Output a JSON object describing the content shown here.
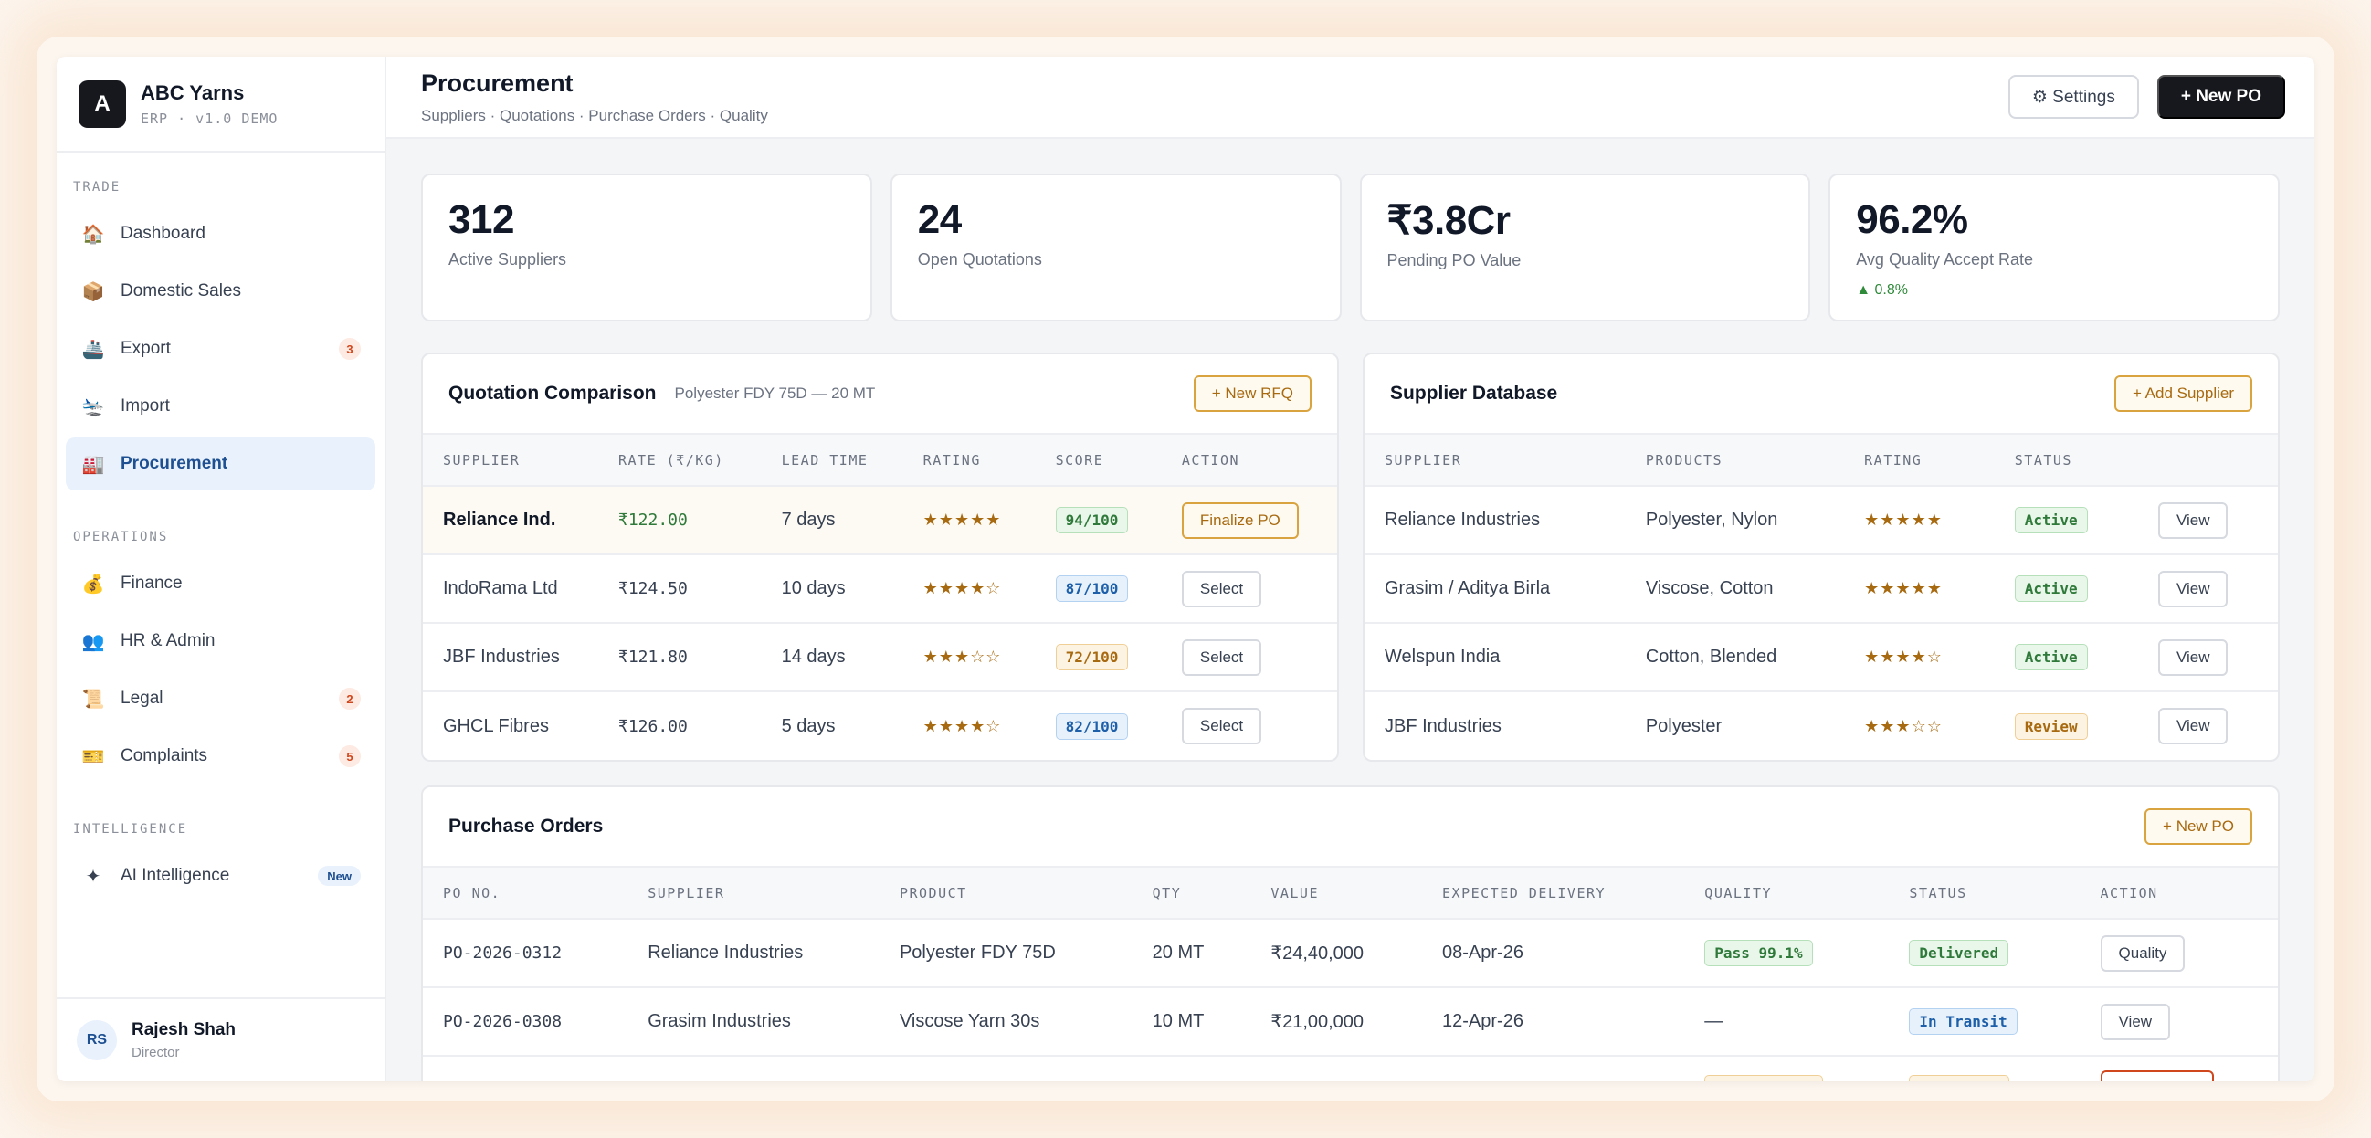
{
  "brand": {
    "logo": "A",
    "name": "ABC Yarns",
    "sub": "ERP · v1.0 DEMO"
  },
  "nav": {
    "sections": [
      {
        "title": "TRADE",
        "items": [
          {
            "label": "Dashboard",
            "icon": "🏠",
            "icon_name": "house-icon"
          },
          {
            "label": "Domestic Sales",
            "icon": "📦",
            "icon_name": "package-icon"
          },
          {
            "label": "Export",
            "icon": "🚢",
            "icon_name": "ship-icon",
            "badge": "3"
          },
          {
            "label": "Import",
            "icon": "🛬",
            "icon_name": "plane-arrival-icon"
          },
          {
            "label": "Procurement",
            "icon": "🏭",
            "icon_name": "factory-icon",
            "active": true
          }
        ]
      },
      {
        "title": "OPERATIONS",
        "items": [
          {
            "label": "Finance",
            "icon": "💰",
            "icon_name": "money-bag-icon"
          },
          {
            "label": "HR & Admin",
            "icon": "👥",
            "icon_name": "people-icon"
          },
          {
            "label": "Legal",
            "icon": "📜",
            "icon_name": "scroll-icon",
            "badge": "2"
          },
          {
            "label": "Complaints",
            "icon": "🎫",
            "icon_name": "ticket-icon",
            "badge": "5"
          }
        ]
      },
      {
        "title": "INTELLIGENCE",
        "items": [
          {
            "label": "AI Intelligence",
            "icon": "✦",
            "icon_name": "sparkle-icon",
            "tag": "New"
          }
        ]
      }
    ]
  },
  "user": {
    "initials": "RS",
    "name": "Rajesh Shah",
    "role": "Director"
  },
  "header": {
    "title": "Procurement",
    "breadcrumb": "Suppliers · Quotations · Purchase Orders · Quality",
    "settings_label": "⚙ Settings",
    "new_po_label": "+ New PO"
  },
  "kpis": [
    {
      "value": "312",
      "label": "Active Suppliers"
    },
    {
      "value": "24",
      "label": "Open Quotations"
    },
    {
      "value": "₹3.8Cr",
      "label": "Pending PO Value"
    },
    {
      "value": "96.2%",
      "label": "Avg Quality Accept Rate",
      "delta": "▲ 0.8%"
    }
  ],
  "quotation": {
    "title": "Quotation Comparison",
    "subtitle": "Polyester FDY 75D — 20 MT",
    "button": "+ New RFQ",
    "columns": [
      "SUPPLIER",
      "RATE (₹/KG)",
      "LEAD TIME",
      "RATING",
      "SCORE",
      "ACTION"
    ],
    "rows": [
      {
        "supplier": "Reliance Ind.",
        "rate": "₹122.00",
        "lead": "7 days",
        "rating": "★★★★★",
        "score": "94/100",
        "score_tone": "green",
        "action": "Finalize PO",
        "highlight": true
      },
      {
        "supplier": "IndoRama Ltd",
        "rate": "₹124.50",
        "lead": "10 days",
        "rating": "★★★★☆",
        "score": "87/100",
        "score_tone": "blue",
        "action": "Select"
      },
      {
        "supplier": "JBF Industries",
        "rate": "₹121.80",
        "lead": "14 days",
        "rating": "★★★☆☆",
        "score": "72/100",
        "score_tone": "amber",
        "action": "Select"
      },
      {
        "supplier": "GHCL Fibres",
        "rate": "₹126.00",
        "lead": "5 days",
        "rating": "★★★★☆",
        "score": "82/100",
        "score_tone": "blue",
        "action": "Select"
      }
    ]
  },
  "suppliers": {
    "title": "Supplier Database",
    "button": "+ Add Supplier",
    "columns": [
      "SUPPLIER",
      "PRODUCTS",
      "RATING",
      "STATUS",
      ""
    ],
    "rows": [
      {
        "name": "Reliance Industries",
        "products": "Polyester, Nylon",
        "rating": "★★★★★",
        "status": "Active",
        "tone": "green",
        "action": "View"
      },
      {
        "name": "Grasim / Aditya Birla",
        "products": "Viscose, Cotton",
        "rating": "★★★★★",
        "status": "Active",
        "tone": "green",
        "action": "View"
      },
      {
        "name": "Welspun India",
        "products": "Cotton, Blended",
        "rating": "★★★★☆",
        "status": "Active",
        "tone": "green",
        "action": "View"
      },
      {
        "name": "JBF Industries",
        "products": "Polyester",
        "rating": "★★★☆☆",
        "status": "Review",
        "tone": "amber",
        "action": "View"
      }
    ]
  },
  "purchase_orders": {
    "title": "Purchase Orders",
    "button": "+ New PO",
    "columns": [
      "PO NO.",
      "SUPPLIER",
      "PRODUCT",
      "QTY",
      "VALUE",
      "EXPECTED DELIVERY",
      "QUALITY",
      "STATUS",
      "ACTION"
    ],
    "rows": [
      {
        "po": "PO-2026-0312",
        "supplier": "Reliance Industries",
        "product": "Polyester FDY 75D",
        "qty": "20 MT",
        "value": "₹24,40,000",
        "delivery": "08-Apr-26",
        "quality": "Pass 99.1%",
        "quality_tone": "green",
        "status": "Delivered",
        "status_tone": "green",
        "action": "Quality"
      },
      {
        "po": "PO-2026-0308",
        "supplier": "Grasim Industries",
        "product": "Viscose Yarn 30s",
        "qty": "10 MT",
        "value": "₹21,00,000",
        "delivery": "12-Apr-26",
        "quality": "—",
        "quality_tone": "",
        "status": "In Transit",
        "status_tone": "blue",
        "action": "View"
      },
      {
        "po": "",
        "supplier": "",
        "product": "",
        "qty": "",
        "value": "",
        "delivery": "",
        "quality": "",
        "quality_tone": "amber",
        "status": "",
        "status_tone": "amber",
        "action": "",
        "action_tone": "red"
      }
    ]
  },
  "colors": {
    "accent_dark": "#16181d",
    "active_nav_bg": "#e8f1fc",
    "active_nav_text": "#1d4f91",
    "amber": "#a86a10",
    "green": "#2f7a3a",
    "blue": "#1d5fa8",
    "badge_red": "#d0471d"
  }
}
